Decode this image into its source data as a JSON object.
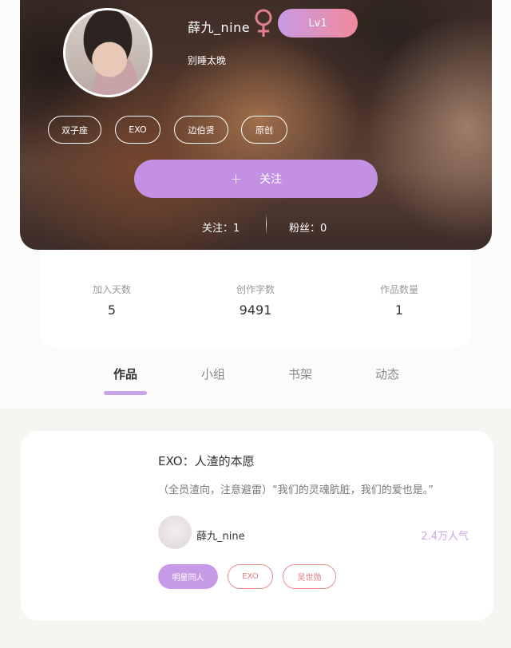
{
  "profile": {
    "username": "薛九_nine",
    "gender_icon": "female-symbol-icon",
    "level": "Lv1",
    "bio": "别睡太晚",
    "tags": [
      "双子座",
      "EXO",
      "边伯贤",
      "原创"
    ],
    "follow_button": {
      "icon": "+",
      "label": "关注"
    },
    "following": "关注：1",
    "fans": "粉丝：0"
  },
  "stats": [
    {
      "label": "加入天数",
      "value": "5"
    },
    {
      "label": "创作字数",
      "value": "9491"
    },
    {
      "label": "作品数量",
      "value": "1"
    }
  ],
  "tabs": [
    "作品",
    "小组",
    "书架",
    "动态"
  ],
  "active_tab": 0,
  "work": {
    "title": "EXO：人渣的本愿",
    "description": "（全员渣向，注意避雷）“我们的灵魂肮脏，我们的爱也是。”",
    "author": "薛九_nine",
    "popularity": "2.4万人气",
    "tags": [
      "明星同人",
      "EXO",
      "吴世勋"
    ]
  },
  "colors": {
    "accent_purple": "#c390e4",
    "level_gradient_start": "#c99ae6",
    "level_gradient_end": "#f08a9a",
    "tag_outline_red": "#e98e8e",
    "popularity_color": "#c8a6e6",
    "female_icon": "#e0808e"
  }
}
